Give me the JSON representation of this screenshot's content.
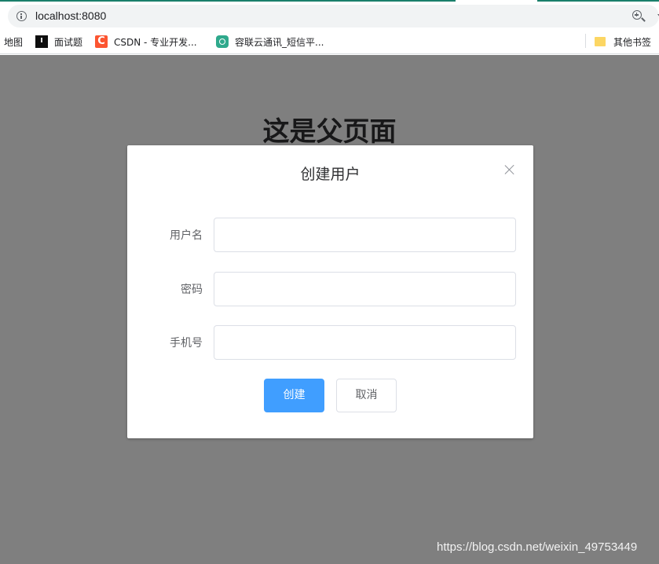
{
  "browser": {
    "url": "localhost:8080",
    "bookmarks": [
      {
        "label": "地图",
        "icon": "none"
      },
      {
        "label": "面试题",
        "icon": "black-square-icon"
      },
      {
        "label": "CSDN - 专业开发...",
        "icon": "csdn-icon",
        "icon_text": "C"
      },
      {
        "label": "容联云通讯_短信平...",
        "icon": "ronglian-icon"
      }
    ],
    "other_bookmarks": "其他书签"
  },
  "page": {
    "title": "这是父页面"
  },
  "dialog": {
    "title": "创建用户",
    "fields": [
      {
        "label": "用户名",
        "value": "",
        "placeholder": ""
      },
      {
        "label": "密码",
        "value": "",
        "placeholder": ""
      },
      {
        "label": "手机号",
        "value": "",
        "placeholder": ""
      }
    ],
    "buttons": {
      "create": "创建",
      "cancel": "取消"
    }
  },
  "watermark": "https://blog.csdn.net/weixin_49753449",
  "colors": {
    "primary": "#409eff",
    "mask": "rgba(0,0,0,0.5)",
    "csdn": "#fc5531",
    "ronglian": "#2fa98c"
  }
}
